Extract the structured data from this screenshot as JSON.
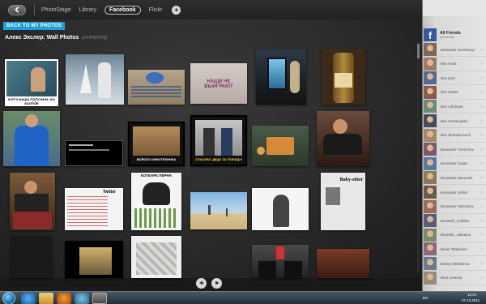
{
  "nav": {
    "items": [
      "PhotoStage",
      "Library",
      "Facebook",
      "Flickr"
    ],
    "add_label": "+"
  },
  "header": {
    "back_label": "BACK TO MY PHOTOS",
    "album_title": "Алекс Экслер: Wall Photos",
    "count": "(29 PHOTOS)"
  },
  "photos": {
    "p1_caption": "В ЕГЭ МАША ПОЛУЧИЛА 100 БАЛЛОВ",
    "p4_text": "НАШИ НЕ ВЫИГРАЮТ",
    "p8_caption": "ВОЙСКО КИНОТЕХНИКА",
    "p9_caption": "СПАСИБО ДЕДУ ЗА ПОБЕДУ!",
    "p13_title": "КОТЕАРХ ПЕРНА",
    "p14_title": "Twitter",
    "p17_text": "Baby-sitter"
  },
  "friends": {
    "all_label": "All Friends",
    "all_sub": "(90 friends)",
    "names": [
      "Aleksandr Gershanyr",
      "Alex Arais",
      "Alex Eyin",
      "Alex Isotas",
      "Alex Likhtman",
      "Alex Semenyaka",
      "Alex Shenderovich",
      "Alexander Fomichev",
      "Alexander Gagin",
      "Alexander Muravski",
      "Alexander Ushal",
      "Alexander Zelentsov",
      "Alexandr_onikiibe",
      "Alexeeik...adsatiya",
      "Alexei Tolkachev",
      "Alexey Mitrofanov",
      "Alina Lolocka"
    ]
  },
  "taskbar": {
    "lang": "EN",
    "time": "12:01",
    "date": "27.12.2011"
  },
  "colors": {
    "accent": "#1fa0dc",
    "facebook": "#3b5998"
  }
}
